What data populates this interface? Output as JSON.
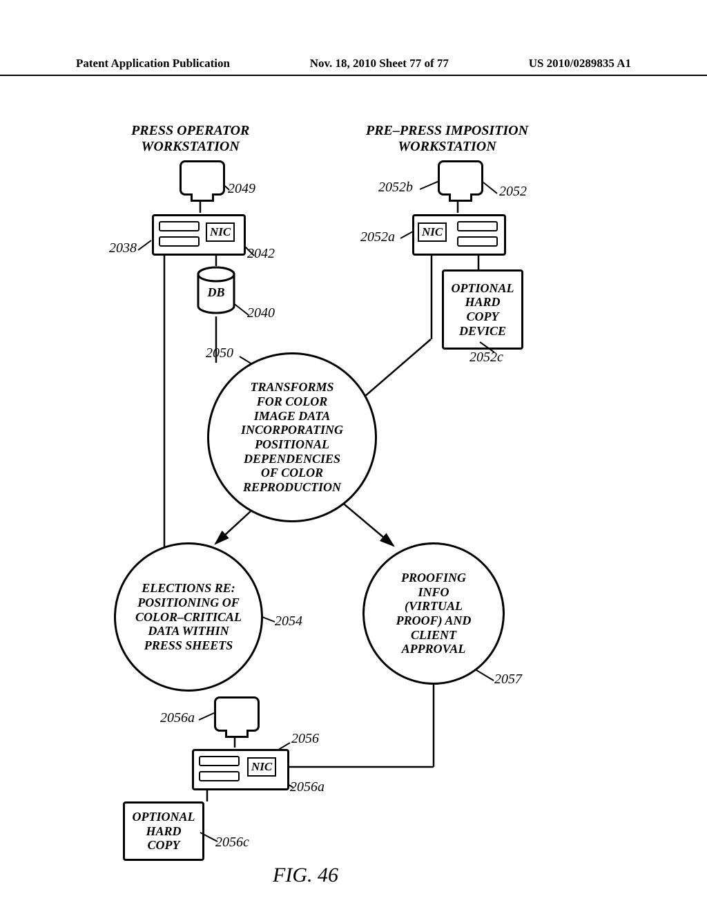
{
  "header": {
    "left": "Patent Application Publication",
    "center": "Nov. 18, 2010  Sheet 77 of 77",
    "right": "US 2010/0289835 A1"
  },
  "titles": {
    "left_ws": "PRESS OPERATOR\nWORKSTATION",
    "right_ws": "PRE–PRESS IMPOSITION\nWORKSTATION"
  },
  "refs": {
    "r2038": "2038",
    "r2040": "2040",
    "r2042": "2042",
    "r2049": "2049",
    "r2050": "2050",
    "r2052": "2052",
    "r2052a": "2052a",
    "r2052b": "2052b",
    "r2052c": "2052c",
    "r2054": "2054",
    "r2056": "2056",
    "r2056a_top": "2056a",
    "r2056a_bottom": "2056a",
    "r2056c": "2056c",
    "r2057": "2057"
  },
  "nic": "NIC",
  "db": "DB",
  "circles": {
    "transforms": "TRANSFORMS\nFOR COLOR\nIMAGE DATA\nINCORPORATING\nPOSITIONAL\nDEPENDENCIES\nOF COLOR\nREPRODUCTION",
    "elections": "ELECTIONS RE:\nPOSITIONING OF\nCOLOR–CRITICAL\nDATA WITHIN\nPRESS SHEETS",
    "proofing": "PROOFING\nINFO\n(VIRTUAL\nPROOF) AND\nCLIENT\nAPPROVAL"
  },
  "boxes": {
    "optional_hard_copy_device": "OPTIONAL\nHARD\nCOPY\nDEVICE",
    "optional_hard_copy": "OPTIONAL\nHARD\nCOPY"
  },
  "figure": "FIG. 46"
}
